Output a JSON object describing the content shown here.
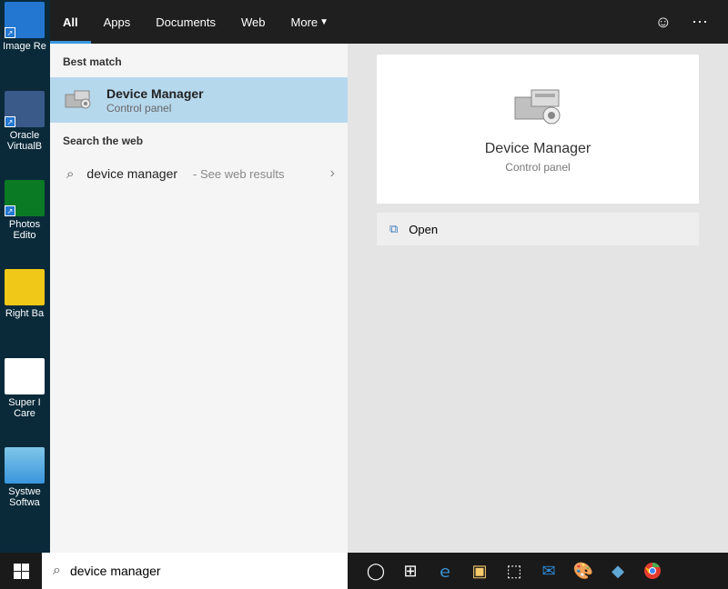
{
  "tabs": {
    "all": "All",
    "apps": "Apps",
    "documents": "Documents",
    "web": "Web",
    "more": "More"
  },
  "sections": {
    "best": "Best match",
    "web": "Search the web"
  },
  "best_result": {
    "title": "Device Manager",
    "subtitle": "Control panel"
  },
  "web_result": {
    "query": "device manager",
    "hint": "- See web results"
  },
  "preview": {
    "title": "Device Manager",
    "subtitle": "Control panel"
  },
  "actions": {
    "open": "Open"
  },
  "search_value": "device manager",
  "desktop": {
    "image": "Image Re",
    "oracle": "Oracle VirtualB",
    "photos": "Photos Edito",
    "rightba": "Right Ba",
    "super": "Super I Care",
    "systwe": "Systwe Softwa"
  }
}
